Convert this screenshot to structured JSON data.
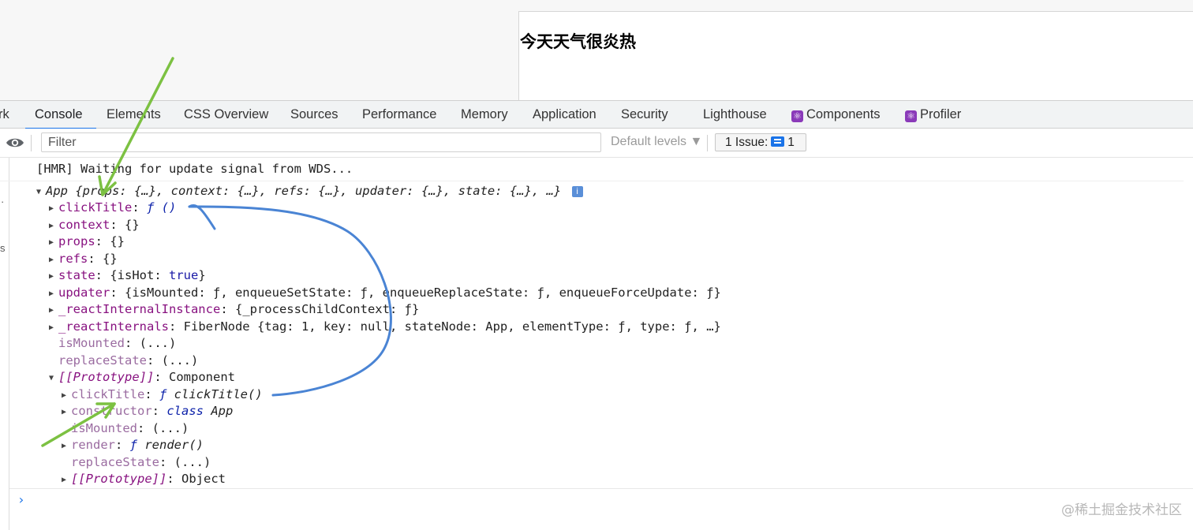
{
  "page": {
    "heading": "今天天气很炎热"
  },
  "devtools": {
    "tabs": [
      {
        "label": "rk"
      },
      {
        "label": "Console"
      },
      {
        "label": "Elements"
      },
      {
        "label": "CSS Overview"
      },
      {
        "label": "Sources"
      },
      {
        "label": "Performance"
      },
      {
        "label": "Memory"
      },
      {
        "label": "Application"
      },
      {
        "label": "Security"
      },
      {
        "label": "Lighthouse"
      },
      {
        "label": "Components",
        "icon": "react-icon"
      },
      {
        "label": "Profiler",
        "icon": "react-icon"
      }
    ],
    "active_tab": "Console",
    "toolbar": {
      "eye_icon": "eye-icon",
      "filter_placeholder": "Filter",
      "levels_label": "Default levels ▼",
      "issues_label": "1 Issue:",
      "issues_count": "1",
      "issue_icon": "message-icon"
    }
  },
  "left_strip": {
    "mark1": "·",
    "mark2": "s"
  },
  "console": {
    "hmr_message": "[HMR] Waiting for update signal from WDS...",
    "app_header": {
      "name": "App",
      "summary": "{props: {…}, context: {…}, refs: {…}, updater: {…}, state: {…}, …}",
      "info_badge": "i"
    },
    "rows": [
      {
        "key": "clickTitle",
        "value": "ƒ ()"
      },
      {
        "key": "context",
        "value": "{}"
      },
      {
        "key": "props",
        "value": "{}"
      },
      {
        "key": "refs",
        "value": "{}"
      },
      {
        "key": "state",
        "value_prefix": "{isHot: ",
        "value_bool": "true",
        "value_suffix": "}"
      },
      {
        "key": "updater",
        "value": "{isMounted: ƒ, enqueueSetState: ƒ, enqueueReplaceState: ƒ, enqueueForceUpdate: ƒ}"
      },
      {
        "key": "_reactInternalInstance",
        "value": "{_processChildContext: ƒ}"
      },
      {
        "key": "_reactInternals",
        "value": "FiberNode {tag: 1, key: null, stateNode: App, elementType: ƒ, type: ƒ, …}"
      },
      {
        "key": "isMounted",
        "value": "(...)"
      },
      {
        "key": "replaceState",
        "value": "(...)"
      },
      {
        "key": "[[Prototype]]",
        "value": "Component"
      }
    ],
    "proto_rows": [
      {
        "key": "clickTitle",
        "value_f": "ƒ",
        "value": " clickTitle()"
      },
      {
        "key": "constructor",
        "value_f": "class",
        "value": " App"
      },
      {
        "key": "isMounted",
        "value": "(...)"
      },
      {
        "key": "render",
        "value_f": "ƒ",
        "value": " render()"
      },
      {
        "key": "replaceState",
        "value": "(...)"
      },
      {
        "key": "[[Prototype]]",
        "value": "Object"
      }
    ],
    "prompt_symbol": "›"
  },
  "watermark": "@稀土掘金技术社区",
  "colors": {
    "accent": "#1a73e8",
    "keyword": "#881280",
    "annotation_green": "#7cc142",
    "annotation_blue": "#4a84d4",
    "react_purple": "#8a3ab9"
  }
}
